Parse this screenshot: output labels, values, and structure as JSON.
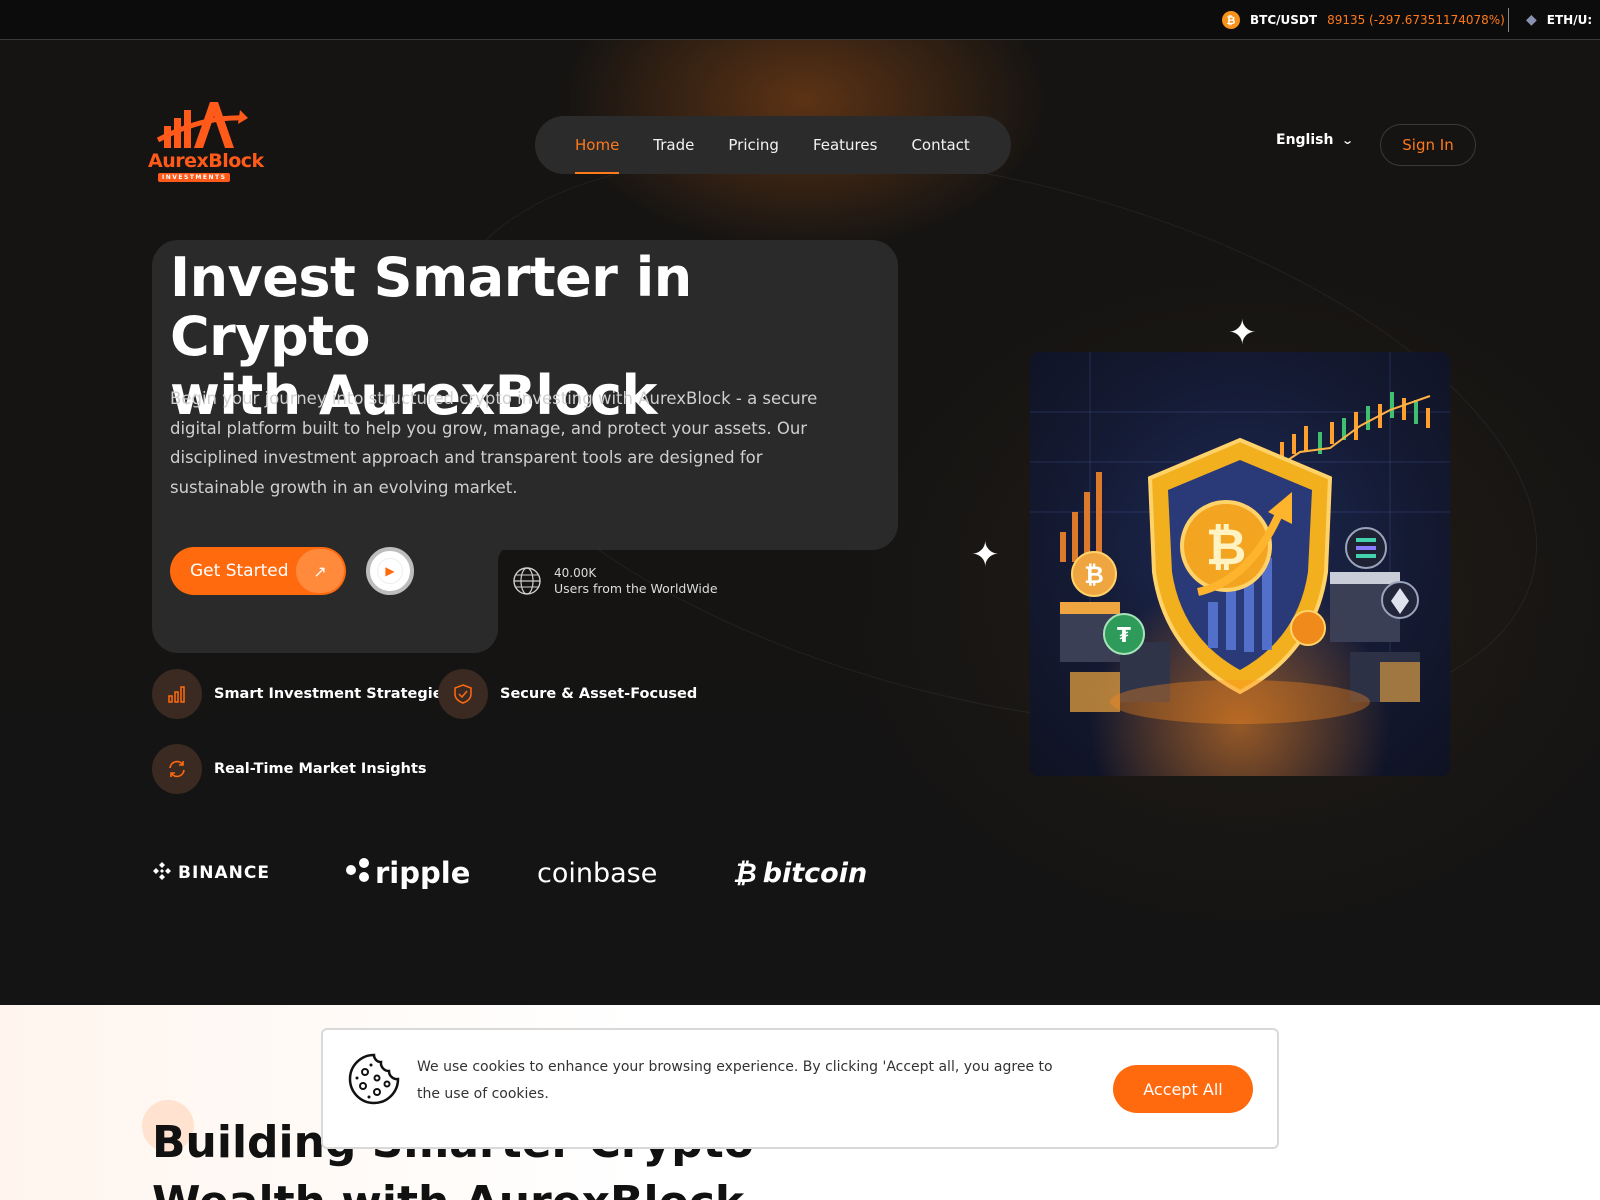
{
  "ticker": {
    "items": [
      {
        "icon": "btc-icon",
        "pair": "BTC/USDT",
        "price": "89135 (-297.67351174078%)"
      },
      {
        "icon": "eth-icon",
        "pair": "ETH/U:"
      }
    ]
  },
  "brand": {
    "name": "AurexBlock",
    "tagline": "INVESTMENTS",
    "color": "#ff5a1a"
  },
  "nav": {
    "items": [
      {
        "label": "Home",
        "active": true
      },
      {
        "label": "Trade"
      },
      {
        "label": "Pricing"
      },
      {
        "label": "Features"
      },
      {
        "label": "Contact"
      }
    ]
  },
  "header": {
    "language": "English",
    "signin_label": "Sign In"
  },
  "hero": {
    "title_line1": "Invest Smarter in Crypto",
    "title_line2": "with AurexBlock",
    "description": "Begin your journey into structured crypto investing with AurexBlock - a secure digital platform built to help you grow, manage, and protect your assets. Our disciplined investment approach and transparent tools are designed for sustainable growth in an evolving market.",
    "cta_label": "Get Started",
    "users_count": "40.00K",
    "users_label": "Users from the WorldWide",
    "features": [
      {
        "icon": "chart-bars-icon",
        "label": "Smart Investment Strategies"
      },
      {
        "icon": "shield-check-icon",
        "label": "Secure & Asset-Focused"
      },
      {
        "icon": "refresh-icon",
        "label": "Real-Time Market Insights"
      }
    ],
    "partners": [
      "BINANCE",
      "ripple",
      "coinbase",
      "bitcoin"
    ]
  },
  "section2": {
    "title_line1": "Building Smarter Crypto",
    "title_line2": "Wealth with AurexBlock"
  },
  "cookie": {
    "text": "We use cookies to enhance your browsing experience. By clicking 'Accept all, you agree to the use of cookies.",
    "accept_label": "Accept All"
  },
  "colors": {
    "accent": "#ff6a0e",
    "background": "#121212",
    "card": "#2a2a2a"
  }
}
